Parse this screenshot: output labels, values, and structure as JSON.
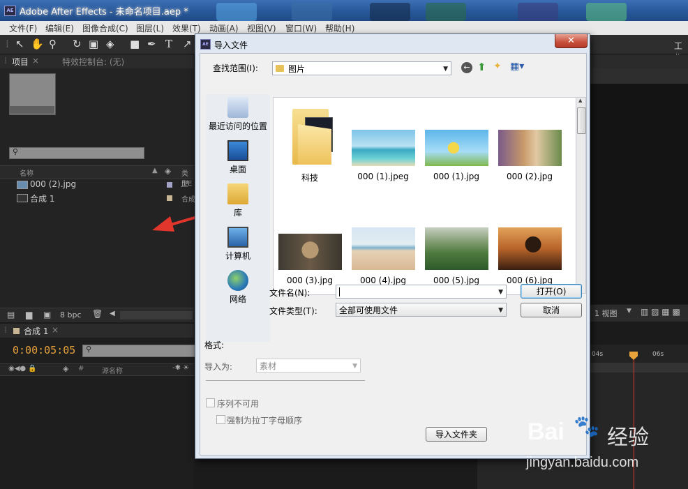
{
  "window": {
    "title": "Adobe After Effects - 未命名项目.aep *",
    "app_icon": "AE"
  },
  "menu": [
    "文件(F)",
    "编辑(E)",
    "图像合成(C)",
    "图层(L)",
    "效果(T)",
    "动画(A)",
    "视图(V)",
    "窗口(W)",
    "帮助(H)"
  ],
  "toolbar": {
    "workspace_label": "工作"
  },
  "project_panel": {
    "tab_project": "项目",
    "tab_effects": "特效控制台: (无)",
    "col_name": "名称",
    "col_type": "类型",
    "items": [
      {
        "name": "000 (2).jpg",
        "type": "JPE"
      },
      {
        "name": "合成 1",
        "type": "合成"
      }
    ],
    "bpc": "8 bpc"
  },
  "timeline": {
    "tab": "合成 1",
    "timecode": "0:00:05:05",
    "col_source": "源名称",
    "ruler": [
      "04s",
      "06s"
    ]
  },
  "viewer": {
    "views_label": "1 视图"
  },
  "dialog": {
    "title": "导入文件",
    "look_in_label": "查找范围(I):",
    "look_in_value": "图片",
    "places": [
      "最近访问的位置",
      "桌面",
      "库",
      "计算机",
      "网络"
    ],
    "files": [
      {
        "name": "科技",
        "kind": "folder"
      },
      {
        "name": "000 (1).jpeg",
        "kind": "image"
      },
      {
        "name": "000 (1).jpg",
        "kind": "image"
      },
      {
        "name": "000 (2).jpg",
        "kind": "image"
      },
      {
        "name": "000 (3).jpg",
        "kind": "image"
      },
      {
        "name": "000 (4).jpg",
        "kind": "image"
      },
      {
        "name": "000 (5).jpg",
        "kind": "image"
      },
      {
        "name": "000 (6).jpg",
        "kind": "image"
      }
    ],
    "filename_label": "文件名(N):",
    "filename_value": "",
    "filetype_label": "文件类型(T):",
    "filetype_value": "全部可使用文件",
    "open_button": "打开(O)",
    "cancel_button": "取消",
    "format_label": "格式:",
    "import_as_label": "导入为:",
    "import_as_value": "素材",
    "sequence_label": "序列不可用",
    "force_alpha_label": "强制为拉丁字母顺序",
    "import_folder_button": "导入文件夹"
  },
  "watermark": {
    "brand": "Bai",
    "brand_suffix": "经验",
    "url": "jingyan.baidu.com"
  },
  "colors": {
    "accent_red": "#e0362c",
    "timecode": "#e8a33a",
    "titlebar": "#2a5a9c"
  }
}
